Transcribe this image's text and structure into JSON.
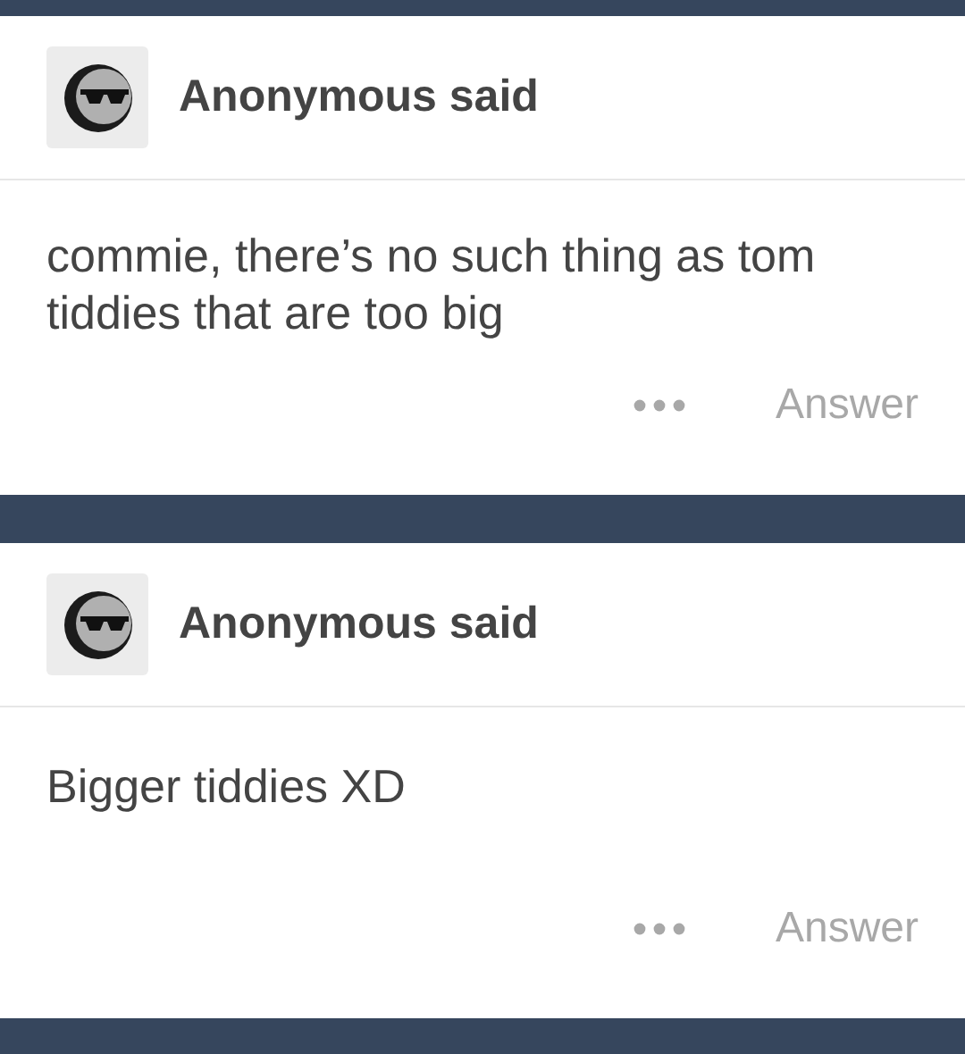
{
  "posts": [
    {
      "author": "Anonymous said",
      "question": "commie, there’s no such thing as tom tiddies that are too big",
      "answer_button": "Answer"
    },
    {
      "author": "Anonymous said",
      "question": "Bigger tiddies XD",
      "answer_button": "Answer"
    }
  ]
}
